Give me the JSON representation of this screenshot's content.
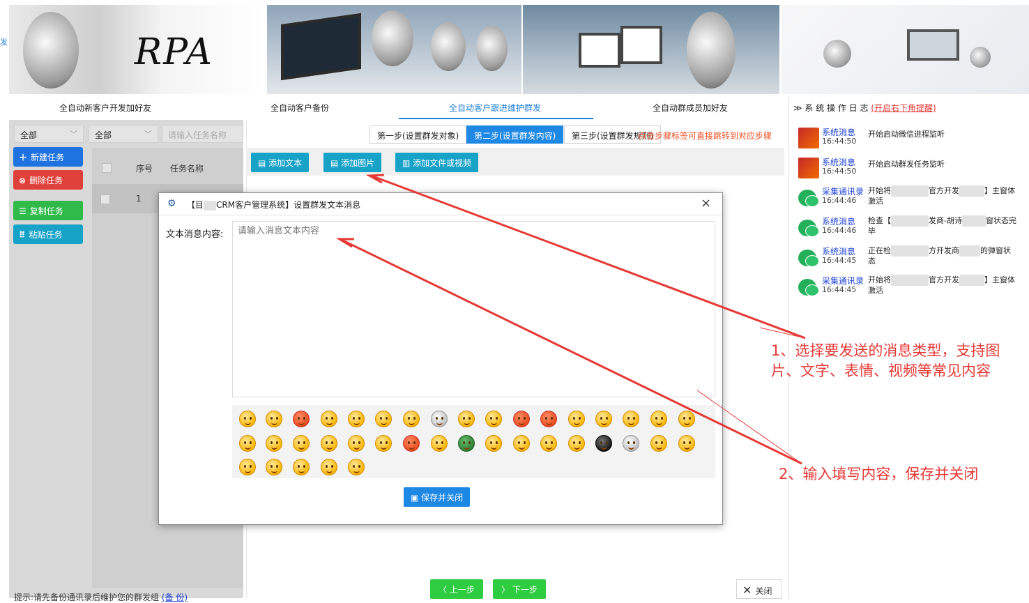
{
  "banner": {
    "logo_text": "RPA"
  },
  "nav": {
    "items": [
      "全自动新客户开发加好友",
      "全自动客户备份",
      "全自动客户跟进维护群发",
      "全自动群成员加好友"
    ],
    "active_index": 2
  },
  "left": {
    "filter1": "全部",
    "filter2": "全部",
    "search_placeholder": "请输入任务名称",
    "buttons": {
      "new_task": "新建任务",
      "delete_task": "删除任务",
      "copy_task": "复制任务",
      "paste_task": "粘贴任务"
    },
    "table": {
      "col_index": "序号",
      "col_name": "任务名称",
      "rows": [
        {
          "index": "1"
        }
      ]
    },
    "tip": "提示:请先备份通讯录后维护您的群发组",
    "tip_link": "(备 份)"
  },
  "steps": {
    "step1": "第一步(设置群发对象)",
    "step2": "第二步(设置群发内容)",
    "step3": "第三步(设置群发规则)",
    "hint": "点击步骤标签可直接跳转到对应步骤"
  },
  "toolbar": {
    "add_text": "添加文本",
    "add_image": "添加图片",
    "add_file": "添加文件或视频"
  },
  "dialog": {
    "title_prefix": "【",
    "title_bracket_fragment": "目",
    "title_rest": "CRM客户管理系统】设置群发文本消息",
    "label": "文本消息内容:",
    "placeholder": "请输入消息文本内容",
    "save_label": "保存并关闭",
    "close_symbol": "×"
  },
  "bottom": {
    "prev": "上一步",
    "next": "下一步",
    "close": "关闭"
  },
  "log": {
    "title": "系 统 操 作 日 志",
    "link": "(开启右下角提醒)",
    "entries": [
      {
        "type": "系统消息",
        "time": "16:44:50",
        "msg": "开始启动微信进程监听",
        "avatar": "system"
      },
      {
        "type": "系统消息",
        "time": "16:44:50",
        "msg": "开始启动群发任务监听",
        "avatar": "system"
      },
      {
        "type": "采集通讯录",
        "time": "16:44:46",
        "msg_a": "开始将",
        "msg_b": "官方开发",
        "msg_c": "】主窗体",
        "msg_d": "激活",
        "avatar": "wechat"
      },
      {
        "type": "系统消息",
        "time": "16:44:46",
        "msg_a": "检查【",
        "msg_b": "发商-胡诗",
        "msg_c": "窗状态完",
        "msg_d": "毕",
        "avatar": "wechat"
      },
      {
        "type": "系统消息",
        "time": "16:44:45",
        "msg_a": "正在检",
        "msg_b": "方开发商",
        "msg_c": "的弹窗状",
        "msg_d": "态",
        "avatar": "wechat"
      },
      {
        "type": "采集通讯录",
        "time": "16:44:45",
        "msg_a": "开始将",
        "msg_b": "官方开发",
        "msg_c": "】主窗体",
        "msg_d": "激活",
        "avatar": "wechat"
      }
    ]
  },
  "annotations": {
    "note1_line1": "1、选择要发送的消息类型，支持图",
    "note1_line2": "片、文字、表情、视频等常见内容",
    "note2": "2、输入填写内容，保存并关闭"
  },
  "colors": {
    "primary": "#1e88e5",
    "teal": "#17a2c8",
    "green": "#2ecc40",
    "danger": "#e53935",
    "annotation": "#e53935"
  }
}
